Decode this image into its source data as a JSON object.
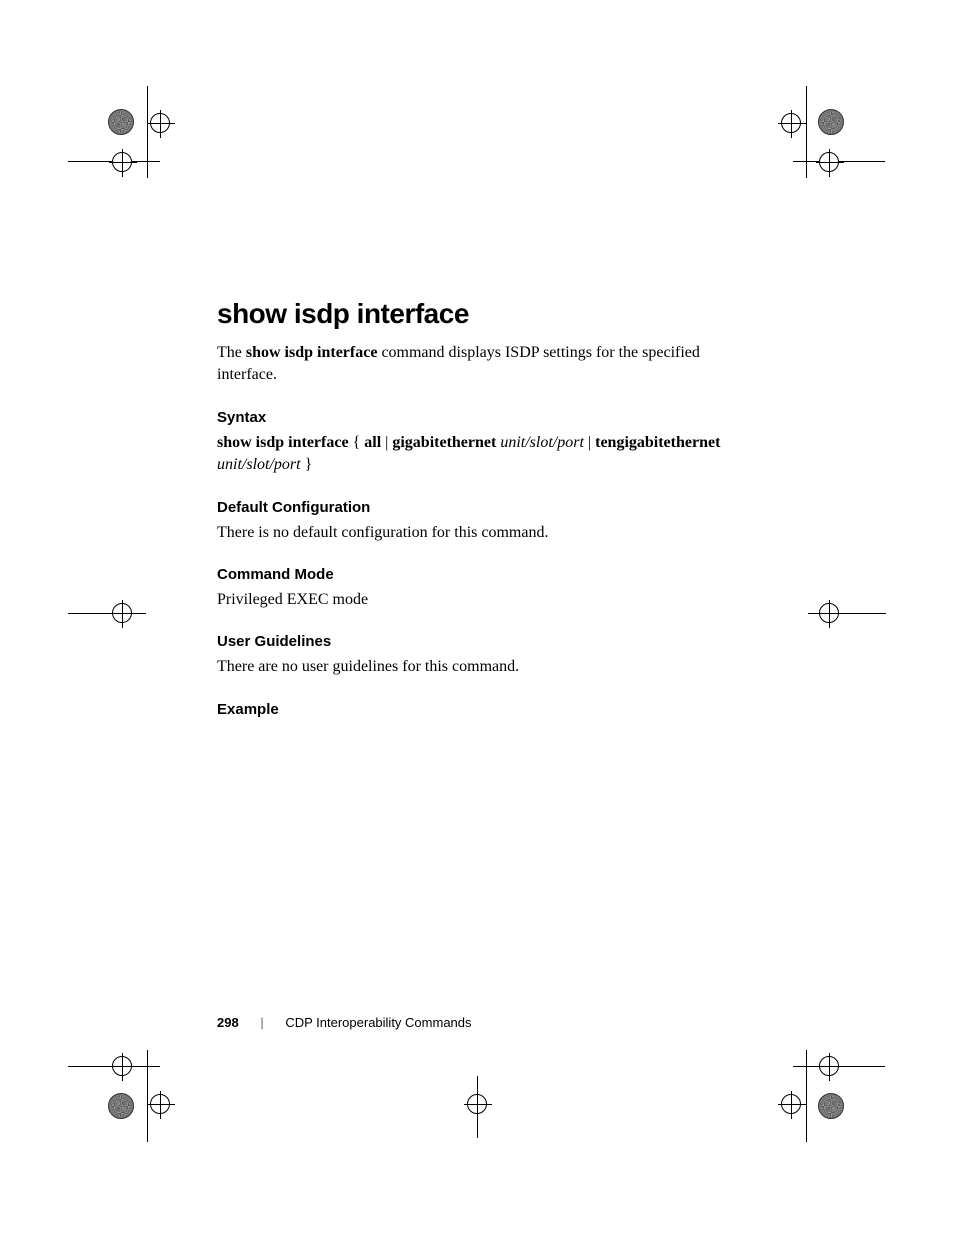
{
  "title": "show isdp interface",
  "description": {
    "pre": "The ",
    "bold": "show isdp interface",
    "post": " command displays ISDP settings for the specified interface."
  },
  "sections": {
    "syntax": {
      "heading": "Syntax",
      "parts": {
        "p1": "show isdp interface",
        "p2": " { ",
        "p3": "all",
        "p4": " | ",
        "p5": "gigabitethernet",
        "p6": " ",
        "p7": "unit/slot/port",
        "p8": " | ",
        "p9": "tengigabitethernet",
        "p10": " ",
        "p11": "unit/slot/port",
        "p12": " }"
      }
    },
    "default_config": {
      "heading": "Default Configuration",
      "body": "There is no default configuration for this command."
    },
    "command_mode": {
      "heading": "Command Mode",
      "body": "Privileged EXEC mode"
    },
    "user_guidelines": {
      "heading": "User Guidelines",
      "body": "There are no user guidelines for this command."
    },
    "example": {
      "heading": "Example"
    }
  },
  "footer": {
    "page": "298",
    "section": "CDP Interoperability Commands"
  }
}
